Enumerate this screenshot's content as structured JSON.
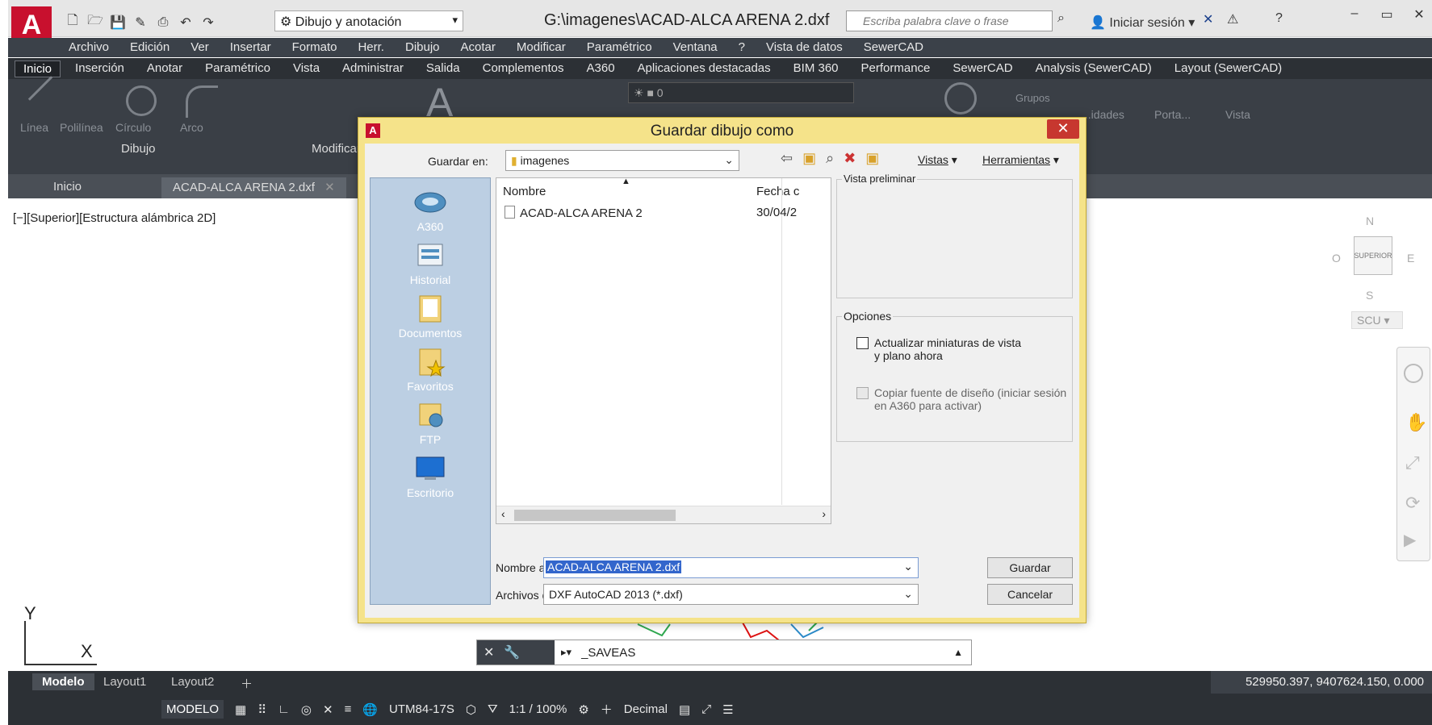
{
  "app": {
    "logo": "A",
    "workspace": "Dibujo y anotación",
    "window_title": "G:\\imagenes\\ACAD-ALCA ARENA 2.dxf",
    "search_placeholder": "Escriba palabra clave o frase",
    "signin": "Iniciar sesión"
  },
  "menu": [
    "Archivo",
    "Edición",
    "Ver",
    "Insertar",
    "Formato",
    "Herr.",
    "Dibujo",
    "Acotar",
    "Modificar",
    "Paramétrico",
    "Ventana",
    "?",
    "Vista de datos",
    "SewerCAD"
  ],
  "ribbon_tabs": [
    "Inicio",
    "Inserción",
    "Anotar",
    "Paramétrico",
    "Vista",
    "Administrar",
    "Salida",
    "Complementos",
    "A360",
    "Aplicaciones destacadas",
    "BIM 360",
    "Performance",
    "SewerCAD",
    "Analysis (SewerCAD)",
    "Layout (SewerCAD)"
  ],
  "ribbon": {
    "tools": [
      "Línea",
      "Polilínea",
      "Círculo",
      "Arco"
    ],
    "layer_value": "0",
    "panel_dibujo": "Dibujo",
    "panel_modificar": "Modificar",
    "right_tools": [
      "Grupos",
      "...idades",
      "Porta...",
      "Vista"
    ]
  },
  "doc_tabs": [
    "Inicio",
    "ACAD-ALCA ARENA 2.dxf"
  ],
  "viewport_label": "[−][Superior][Estructura alámbrica 2D]",
  "viewcube": {
    "face": "SUPERIOR",
    "n": "N",
    "s": "S",
    "e": "E",
    "w": "O",
    "ucs": "SCU"
  },
  "ucs": {
    "x": "X",
    "y": "Y"
  },
  "command": {
    "input": "_SAVEAS"
  },
  "layout_tabs": [
    "Modelo",
    "Layout1",
    "Layout2"
  ],
  "coords": "529950.397, 9407624.150, 0.000",
  "status": {
    "model": "MODELO",
    "crs": "UTM84-17S",
    "scale": "1:1 / 100%",
    "units": "Decimal"
  },
  "dialog": {
    "title": "Guardar dibujo como",
    "save_in_label": "Guardar en:",
    "save_in_value": "imagenes",
    "views_menu": "Vistas",
    "tools_menu": "Herramientas",
    "places": [
      "A360",
      "Historial",
      "Documentos",
      "Favoritos",
      "FTP",
      "Escritorio"
    ],
    "col_name": "Nombre",
    "col_date": "Fecha c",
    "file_name": "ACAD-ALCA ARENA 2",
    "file_date": "30/04/2",
    "preview_label": "Vista preliminar",
    "options_label": "Opciones",
    "option1_line1": "Actualizar miniaturas de vista",
    "option1_line2": "y plano ahora",
    "option2_line1": "Copiar fuente de diseño (iniciar sesión",
    "option2_line2": "en A360 para activar)",
    "filename_label": "Nombre archivo:",
    "filename_value": "ACAD-ALCA ARENA 2.dxf",
    "filetype_label": "Archivos de tipo:",
    "filetype_value": "DXF AutoCAD 2013 (*.dxf)",
    "save_button": "Guardar",
    "cancel_button": "Cancelar"
  }
}
